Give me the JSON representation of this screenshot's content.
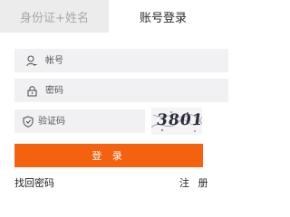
{
  "tabs": [
    {
      "label": "身份证+姓名",
      "active": false
    },
    {
      "label": "账号登录",
      "active": true
    }
  ],
  "form": {
    "username_placeholder": "帐号",
    "password_placeholder": "密码",
    "captcha_placeholder": "验证码",
    "captcha_text": "3801",
    "login_label": "登 录",
    "forgot_label": "找回密码",
    "register_label": "注 册"
  },
  "icons": {
    "username": "user-icon",
    "password": "lock-icon",
    "captcha": "shield-icon"
  },
  "colors": {
    "accent": "#f5620f",
    "tab_inactive_bg": "#ececec",
    "field_bg": "#f1f1f3"
  }
}
